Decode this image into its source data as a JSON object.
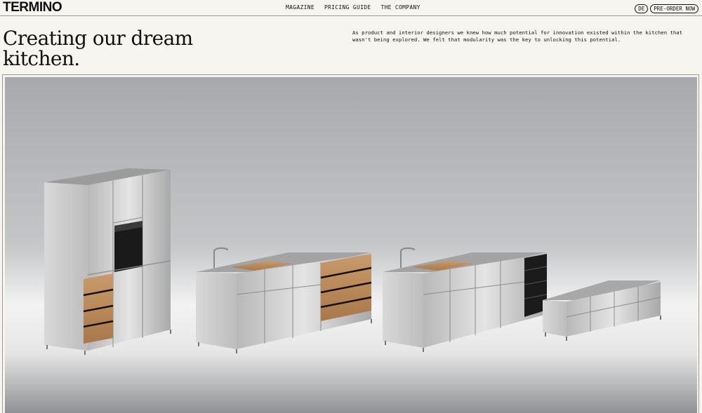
{
  "brand": {
    "logo_text": "TERMINO"
  },
  "nav": {
    "items": [
      {
        "label": "MAGAZINE"
      },
      {
        "label": "PRICING GUIDE"
      },
      {
        "label": "THE COMPANY"
      }
    ]
  },
  "header_actions": {
    "language_label": "DE",
    "preorder_label": "PRE-ORDER NOW"
  },
  "hero_intro": {
    "title_line1": "Creating our dream",
    "title_line2": "kitchen.",
    "description": "As product and interior designers we knew how much potential for innovation existed within the kitchen that wasn't being explored. We felt that modularity was the key to unlocking this potential."
  },
  "hero_image": {
    "subject": "modular-stainless-steel-kitchen-modules"
  },
  "colors": {
    "background": "#f6f5ef",
    "text": "#111111",
    "rule": "#9a9a94",
    "steel": "#c9c9c9",
    "wood": "#b98a5c"
  }
}
